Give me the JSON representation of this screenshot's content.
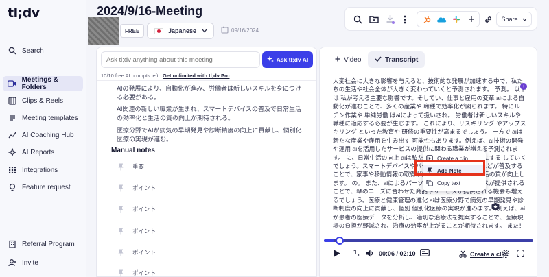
{
  "app": {
    "logo": "tl;dv"
  },
  "sidebar": {
    "items": [
      {
        "label": "Search",
        "icon": "search-icon"
      },
      {
        "label": "Meetings & Folders",
        "icon": "video-icon",
        "active": true
      },
      {
        "label": "Clips & Reels",
        "icon": "clips-icon"
      },
      {
        "label": "Meeting templates",
        "icon": "template-icon"
      },
      {
        "label": "AI Coaching Hub",
        "icon": "coaching-icon"
      },
      {
        "label": "AI Reports",
        "icon": "report-icon"
      },
      {
        "label": "Integrations",
        "icon": "grid-icon"
      },
      {
        "label": "Feature request",
        "icon": "lightbulb-icon"
      }
    ],
    "bottom_items": [
      {
        "label": "Referral Program",
        "icon": "building-icon"
      },
      {
        "label": "Invite",
        "icon": "invite-icon"
      }
    ]
  },
  "header": {
    "title": "2024/9/16-Meeting",
    "badge": "FREE",
    "language": "Japanese",
    "date": "09/16/2024",
    "share_label": "Share"
  },
  "ask": {
    "placeholder": "Ask tl;dv anything about this meeting",
    "button_label": "Ask tl;dv AI",
    "prompts_left": "10/10 free AI prompts left.",
    "upgrade_link": "Get unlimited with tl;dv Pro"
  },
  "ai_notes": [
    "AIの発展により、自動化が進み、労働者は新しいスキルを身につける必要がある。",
    "AI関連の新しい職業が生まれ、スマートデバイスの普及で日常生活の効率化と生活の質の向上が期待される。",
    "医療分野でAIが病気の早期発見や診断精度の向上に貢献し、個別化医療の実現が進む。"
  ],
  "manual_notes": {
    "heading": "Manual notes",
    "items": [
      "重要",
      "ポイント",
      "ポイント",
      "ポイント",
      "ポイント",
      "ポイント"
    ]
  },
  "tabs": [
    {
      "label": "Video",
      "icon": "plus-icon"
    },
    {
      "label": "Transcript",
      "icon": "check-icon",
      "active": true
    }
  ],
  "transcript_text": "大変社会に大きな影響を与えると、技術的な発展が加速する中で、私たちの生活や社会全体が大きく変わっていくと予測されます。 予測。 以下は 私が考える主要な影響です。そしてい、仕事と雇用の変革 aiによる自動化が進むことで、多くの産業や 職種で効率化が図られます。 特にルーチン作業や 単純労働 はaiによって扱いされ。 労働者は新しいスキルや 職種に適応する必要が生じます。 これにより、リスキリング やアップスキリング といった教育や 研修の重要性が高まるでしょう。 一方で aiは新たな産業や雇用を生み出す 可能性もあります。例えば、ai技術の開発や運用 aiを活用したサービスの提供に関わる職業が増える予測されます。 に、日常生活の向上 aiは私たちの生活をさらに便利にする していくでしょう。スマートデバイスやバーチャルアシスタントなどが普及することで、家事や移動情報の取得が効率化され、 日々の生活の質が向上します。 の。 また、aiによるパーソナライズされたサービスが提供されることで、琴のニーズに合わせた商品やサービスが提供される機会も増えるでしょう。医療と健康管理の進化 aiは医療分野で病気の早期発見や診断制度の向上に貢献し、個別 個別化医療の実現が進みます。 例えば、aiが患者の医療データを分析し、適切な治療法を提案することで、医療現場の負担が軽減され、治療の効率が上がることが期待されます。 また！ 治療。 また！ 治療。",
  "context_menu": {
    "items": [
      {
        "label": "Create a clip",
        "icon": "clip-icon"
      },
      {
        "label": "Add Note",
        "icon": "pin-icon",
        "highlighted": true
      },
      {
        "label": "Copy text",
        "icon": "copy-icon"
      }
    ]
  },
  "player": {
    "progress": 0.05,
    "speed": "1",
    "speed_suffix": "x",
    "time": "00:06 / 02:10",
    "clip_label": "Create a clip"
  },
  "colors": {
    "accent": "#3b3fe8",
    "highlight_box": "#e5321c",
    "active_nav_bg": "#e5e6f6"
  }
}
